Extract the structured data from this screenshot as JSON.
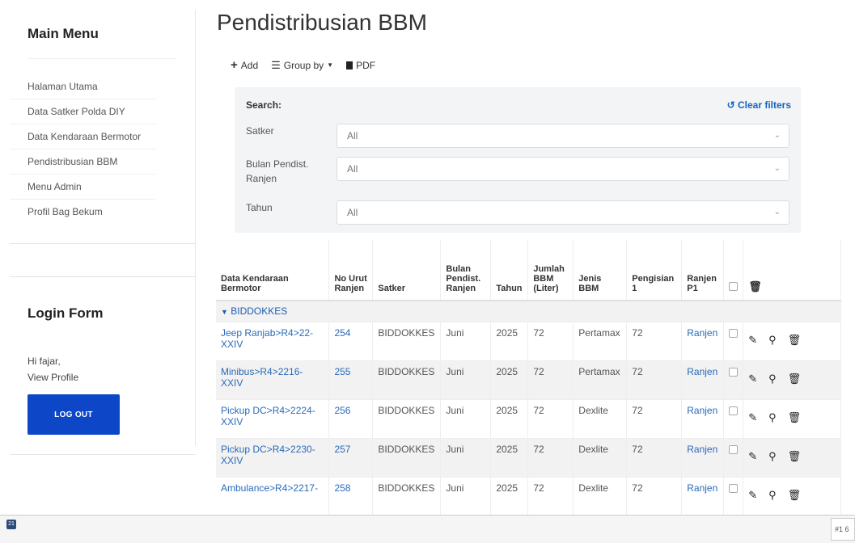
{
  "sidebar": {
    "menu_title": "Main Menu",
    "items": [
      {
        "label": "Halaman Utama"
      },
      {
        "label": "Data Satker Polda DIY"
      },
      {
        "label": "Data Kendaraan Bermotor"
      },
      {
        "label": "Pendistribusian BBM"
      },
      {
        "label": "Menu Admin"
      },
      {
        "label": "Profil Bag Bekum"
      }
    ],
    "login_title": "Login Form",
    "greeting": "Hi fajar,",
    "view_profile": "View Profile",
    "logout": "LOG OUT"
  },
  "page_title": "Pendistribusian BBM",
  "toolbar": {
    "add": "Add",
    "group_by": "Group by",
    "pdf": "PDF"
  },
  "search": {
    "label": "Search:",
    "clear": "Clear filters",
    "filters": [
      {
        "label": "Satker",
        "value": "All"
      },
      {
        "label": "Bulan Pendist. Ranjen",
        "value": "All"
      },
      {
        "label": "Tahun",
        "value": "All"
      }
    ]
  },
  "table": {
    "headers": {
      "kendaraan": "Data Kendaraan Bermotor",
      "no_urut": "No Urut Ranjen",
      "satker": "Satker",
      "bulan": "Bulan Pendist. Ranjen",
      "tahun": "Tahun",
      "jumlah": "Jumlah BBM (Liter)",
      "jenis": "Jenis BBM",
      "pengisian": "Pengisian 1",
      "ranjen": "Ranjen P1"
    },
    "group": "BIDDOKKES",
    "rows": [
      {
        "kendaraan": "Jeep Ranjab>R4>22-XXIV",
        "no": "254",
        "satker": "BIDDOKKES",
        "bulan": "Juni",
        "tahun": "2025",
        "jumlah": "72",
        "jenis": "Pertamax",
        "pengisian": "72",
        "ranjen": "Ranjen"
      },
      {
        "kendaraan": "Minibus>R4>2216-XXIV",
        "no": "255",
        "satker": "BIDDOKKES",
        "bulan": "Juni",
        "tahun": "2025",
        "jumlah": "72",
        "jenis": "Pertamax",
        "pengisian": "72",
        "ranjen": "Ranjen"
      },
      {
        "kendaraan": "Pickup DC>R4>2224-XXIV",
        "no": "256",
        "satker": "BIDDOKKES",
        "bulan": "Juni",
        "tahun": "2025",
        "jumlah": "72",
        "jenis": "Dexlite",
        "pengisian": "72",
        "ranjen": "Ranjen"
      },
      {
        "kendaraan": "Pickup DC>R4>2230-XXIV",
        "no": "257",
        "satker": "BIDDOKKES",
        "bulan": "Juni",
        "tahun": "2025",
        "jumlah": "72",
        "jenis": "Dexlite",
        "pengisian": "72",
        "ranjen": "Ranjen"
      },
      {
        "kendaraan": "Ambulance>R4>2217-",
        "no": "258",
        "satker": "BIDDOKKES",
        "bulan": "Juni",
        "tahun": "2025",
        "jumlah": "72",
        "jenis": "Dexlite",
        "pengisian": "72",
        "ranjen": "Ranjen"
      }
    ]
  },
  "bottom": {
    "badge": "21",
    "box": "#1 6"
  }
}
